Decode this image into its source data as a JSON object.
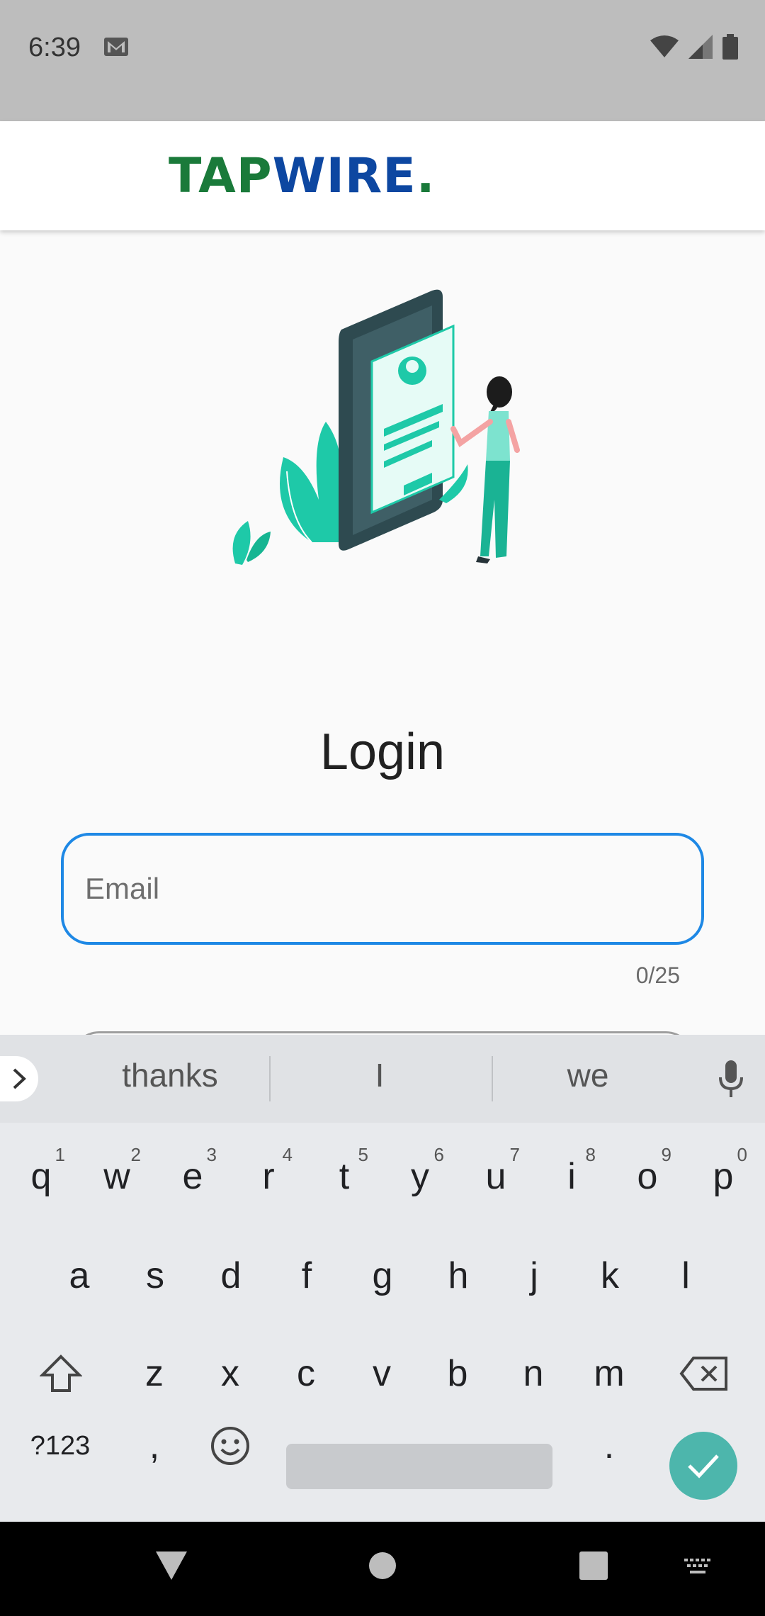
{
  "status_bar": {
    "time": "6:39",
    "icons": [
      "gmail-icon",
      "wifi-icon",
      "signal-icon",
      "battery-icon"
    ]
  },
  "app_bar": {
    "logo_part1": "TAP",
    "logo_part2": "WIRE",
    "logo_part3": "."
  },
  "login": {
    "title": "Login",
    "email_placeholder": "Email",
    "email_value": "",
    "counter": "0/25"
  },
  "keyboard": {
    "suggestions": [
      "thanks",
      "I",
      "we"
    ],
    "row1": [
      {
        "k": "q",
        "n": "1"
      },
      {
        "k": "w",
        "n": "2"
      },
      {
        "k": "e",
        "n": "3"
      },
      {
        "k": "r",
        "n": "4"
      },
      {
        "k": "t",
        "n": "5"
      },
      {
        "k": "y",
        "n": "6"
      },
      {
        "k": "u",
        "n": "7"
      },
      {
        "k": "i",
        "n": "8"
      },
      {
        "k": "o",
        "n": "9"
      },
      {
        "k": "p",
        "n": "0"
      }
    ],
    "row2": [
      "a",
      "s",
      "d",
      "f",
      "g",
      "h",
      "j",
      "k",
      "l"
    ],
    "row3": [
      "z",
      "x",
      "c",
      "v",
      "b",
      "n",
      "m"
    ],
    "symbols_label": "?123",
    "comma": ",",
    "period": "."
  },
  "colors": {
    "brand_green": "#1a7a3a",
    "brand_blue": "#0d47a1",
    "focus_blue": "#1e88e5",
    "accent_teal": "#4db6ac"
  }
}
